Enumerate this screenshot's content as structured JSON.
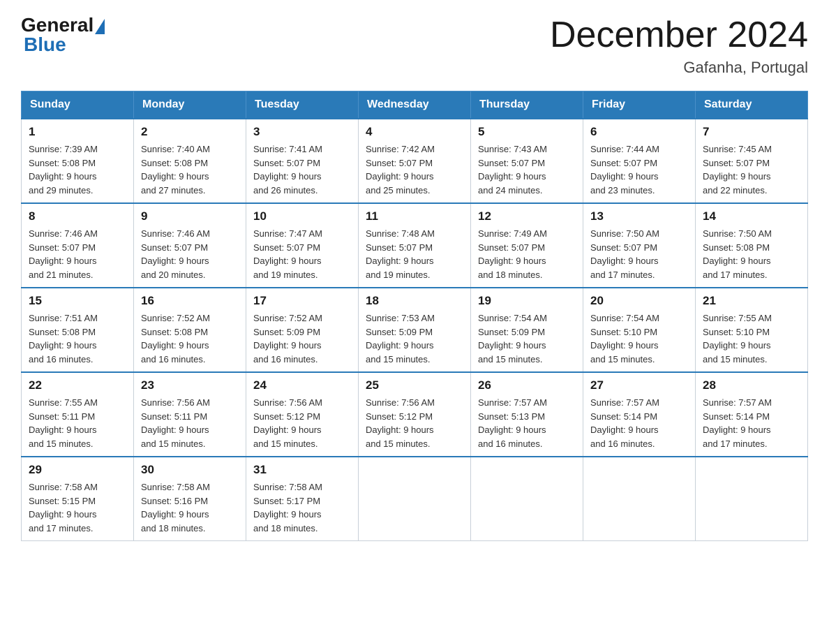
{
  "header": {
    "logo_general": "General",
    "logo_blue": "Blue",
    "month_title": "December 2024",
    "location": "Gafanha, Portugal"
  },
  "days_of_week": [
    "Sunday",
    "Monday",
    "Tuesday",
    "Wednesday",
    "Thursday",
    "Friday",
    "Saturday"
  ],
  "weeks": [
    [
      {
        "day": "1",
        "sunrise": "7:39 AM",
        "sunset": "5:08 PM",
        "daylight": "9 hours and 29 minutes."
      },
      {
        "day": "2",
        "sunrise": "7:40 AM",
        "sunset": "5:08 PM",
        "daylight": "9 hours and 27 minutes."
      },
      {
        "day": "3",
        "sunrise": "7:41 AM",
        "sunset": "5:07 PM",
        "daylight": "9 hours and 26 minutes."
      },
      {
        "day": "4",
        "sunrise": "7:42 AM",
        "sunset": "5:07 PM",
        "daylight": "9 hours and 25 minutes."
      },
      {
        "day": "5",
        "sunrise": "7:43 AM",
        "sunset": "5:07 PM",
        "daylight": "9 hours and 24 minutes."
      },
      {
        "day": "6",
        "sunrise": "7:44 AM",
        "sunset": "5:07 PM",
        "daylight": "9 hours and 23 minutes."
      },
      {
        "day": "7",
        "sunrise": "7:45 AM",
        "sunset": "5:07 PM",
        "daylight": "9 hours and 22 minutes."
      }
    ],
    [
      {
        "day": "8",
        "sunrise": "7:46 AM",
        "sunset": "5:07 PM",
        "daylight": "9 hours and 21 minutes."
      },
      {
        "day": "9",
        "sunrise": "7:46 AM",
        "sunset": "5:07 PM",
        "daylight": "9 hours and 20 minutes."
      },
      {
        "day": "10",
        "sunrise": "7:47 AM",
        "sunset": "5:07 PM",
        "daylight": "9 hours and 19 minutes."
      },
      {
        "day": "11",
        "sunrise": "7:48 AM",
        "sunset": "5:07 PM",
        "daylight": "9 hours and 19 minutes."
      },
      {
        "day": "12",
        "sunrise": "7:49 AM",
        "sunset": "5:07 PM",
        "daylight": "9 hours and 18 minutes."
      },
      {
        "day": "13",
        "sunrise": "7:50 AM",
        "sunset": "5:07 PM",
        "daylight": "9 hours and 17 minutes."
      },
      {
        "day": "14",
        "sunrise": "7:50 AM",
        "sunset": "5:08 PM",
        "daylight": "9 hours and 17 minutes."
      }
    ],
    [
      {
        "day": "15",
        "sunrise": "7:51 AM",
        "sunset": "5:08 PM",
        "daylight": "9 hours and 16 minutes."
      },
      {
        "day": "16",
        "sunrise": "7:52 AM",
        "sunset": "5:08 PM",
        "daylight": "9 hours and 16 minutes."
      },
      {
        "day": "17",
        "sunrise": "7:52 AM",
        "sunset": "5:09 PM",
        "daylight": "9 hours and 16 minutes."
      },
      {
        "day": "18",
        "sunrise": "7:53 AM",
        "sunset": "5:09 PM",
        "daylight": "9 hours and 15 minutes."
      },
      {
        "day": "19",
        "sunrise": "7:54 AM",
        "sunset": "5:09 PM",
        "daylight": "9 hours and 15 minutes."
      },
      {
        "day": "20",
        "sunrise": "7:54 AM",
        "sunset": "5:10 PM",
        "daylight": "9 hours and 15 minutes."
      },
      {
        "day": "21",
        "sunrise": "7:55 AM",
        "sunset": "5:10 PM",
        "daylight": "9 hours and 15 minutes."
      }
    ],
    [
      {
        "day": "22",
        "sunrise": "7:55 AM",
        "sunset": "5:11 PM",
        "daylight": "9 hours and 15 minutes."
      },
      {
        "day": "23",
        "sunrise": "7:56 AM",
        "sunset": "5:11 PM",
        "daylight": "9 hours and 15 minutes."
      },
      {
        "day": "24",
        "sunrise": "7:56 AM",
        "sunset": "5:12 PM",
        "daylight": "9 hours and 15 minutes."
      },
      {
        "day": "25",
        "sunrise": "7:56 AM",
        "sunset": "5:12 PM",
        "daylight": "9 hours and 15 minutes."
      },
      {
        "day": "26",
        "sunrise": "7:57 AM",
        "sunset": "5:13 PM",
        "daylight": "9 hours and 16 minutes."
      },
      {
        "day": "27",
        "sunrise": "7:57 AM",
        "sunset": "5:14 PM",
        "daylight": "9 hours and 16 minutes."
      },
      {
        "day": "28",
        "sunrise": "7:57 AM",
        "sunset": "5:14 PM",
        "daylight": "9 hours and 17 minutes."
      }
    ],
    [
      {
        "day": "29",
        "sunrise": "7:58 AM",
        "sunset": "5:15 PM",
        "daylight": "9 hours and 17 minutes."
      },
      {
        "day": "30",
        "sunrise": "7:58 AM",
        "sunset": "5:16 PM",
        "daylight": "9 hours and 18 minutes."
      },
      {
        "day": "31",
        "sunrise": "7:58 AM",
        "sunset": "5:17 PM",
        "daylight": "9 hours and 18 minutes."
      },
      null,
      null,
      null,
      null
    ]
  ],
  "labels": {
    "sunrise_prefix": "Sunrise: ",
    "sunset_prefix": "Sunset: ",
    "daylight_prefix": "Daylight: "
  }
}
